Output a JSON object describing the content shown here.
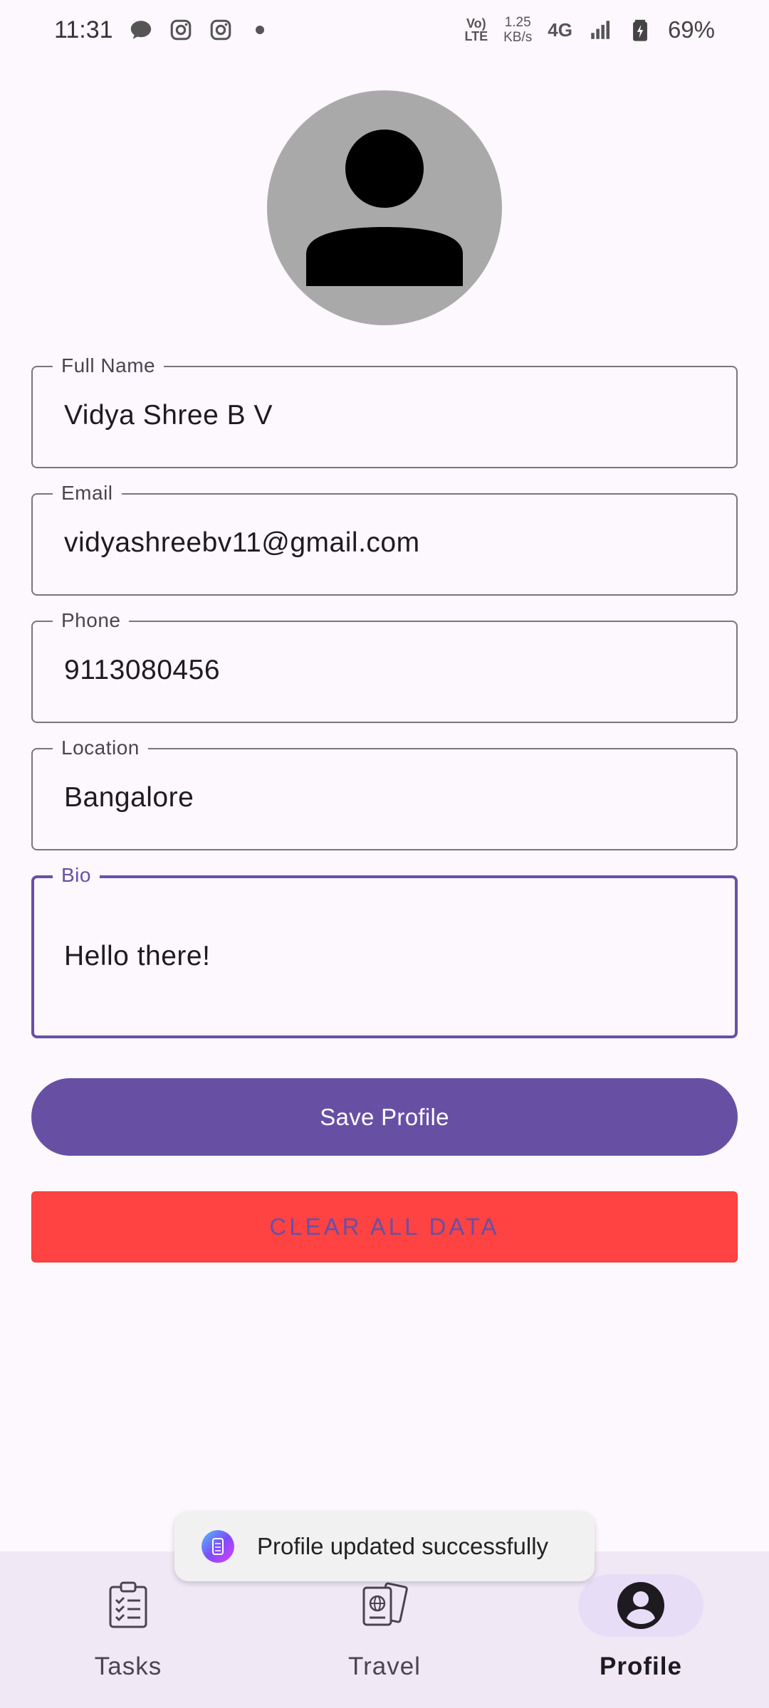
{
  "status_bar": {
    "time": "11:31",
    "volte_top": "Vo)",
    "volte_bottom": "LTE",
    "speed_value": "1.25",
    "speed_unit": "KB/s",
    "network": "4G",
    "battery": "69%"
  },
  "form": {
    "full_name": {
      "label": "Full Name",
      "value": "Vidya Shree B V"
    },
    "email": {
      "label": "Email",
      "value": "vidyashreebv11@gmail.com"
    },
    "phone": {
      "label": "Phone",
      "value": "9113080456"
    },
    "location": {
      "label": "Location",
      "value": "Bangalore"
    },
    "bio": {
      "label": "Bio",
      "value": "Hello there!"
    }
  },
  "buttons": {
    "save_label": "Save Profile",
    "clear_label": "CLEAR ALL DATA"
  },
  "toast": {
    "message": "Profile updated successfully"
  },
  "nav": {
    "items": [
      {
        "label": "Tasks",
        "icon": "clipboard-checklist-icon"
      },
      {
        "label": "Travel",
        "icon": "passport-ticket-icon"
      },
      {
        "label": "Profile",
        "icon": "account-circle-icon",
        "active": true
      }
    ]
  },
  "colors": {
    "primary": "#6750a4",
    "danger": "#ff4343",
    "background": "#fdf7fe",
    "nav_background": "#f1e8f6"
  }
}
